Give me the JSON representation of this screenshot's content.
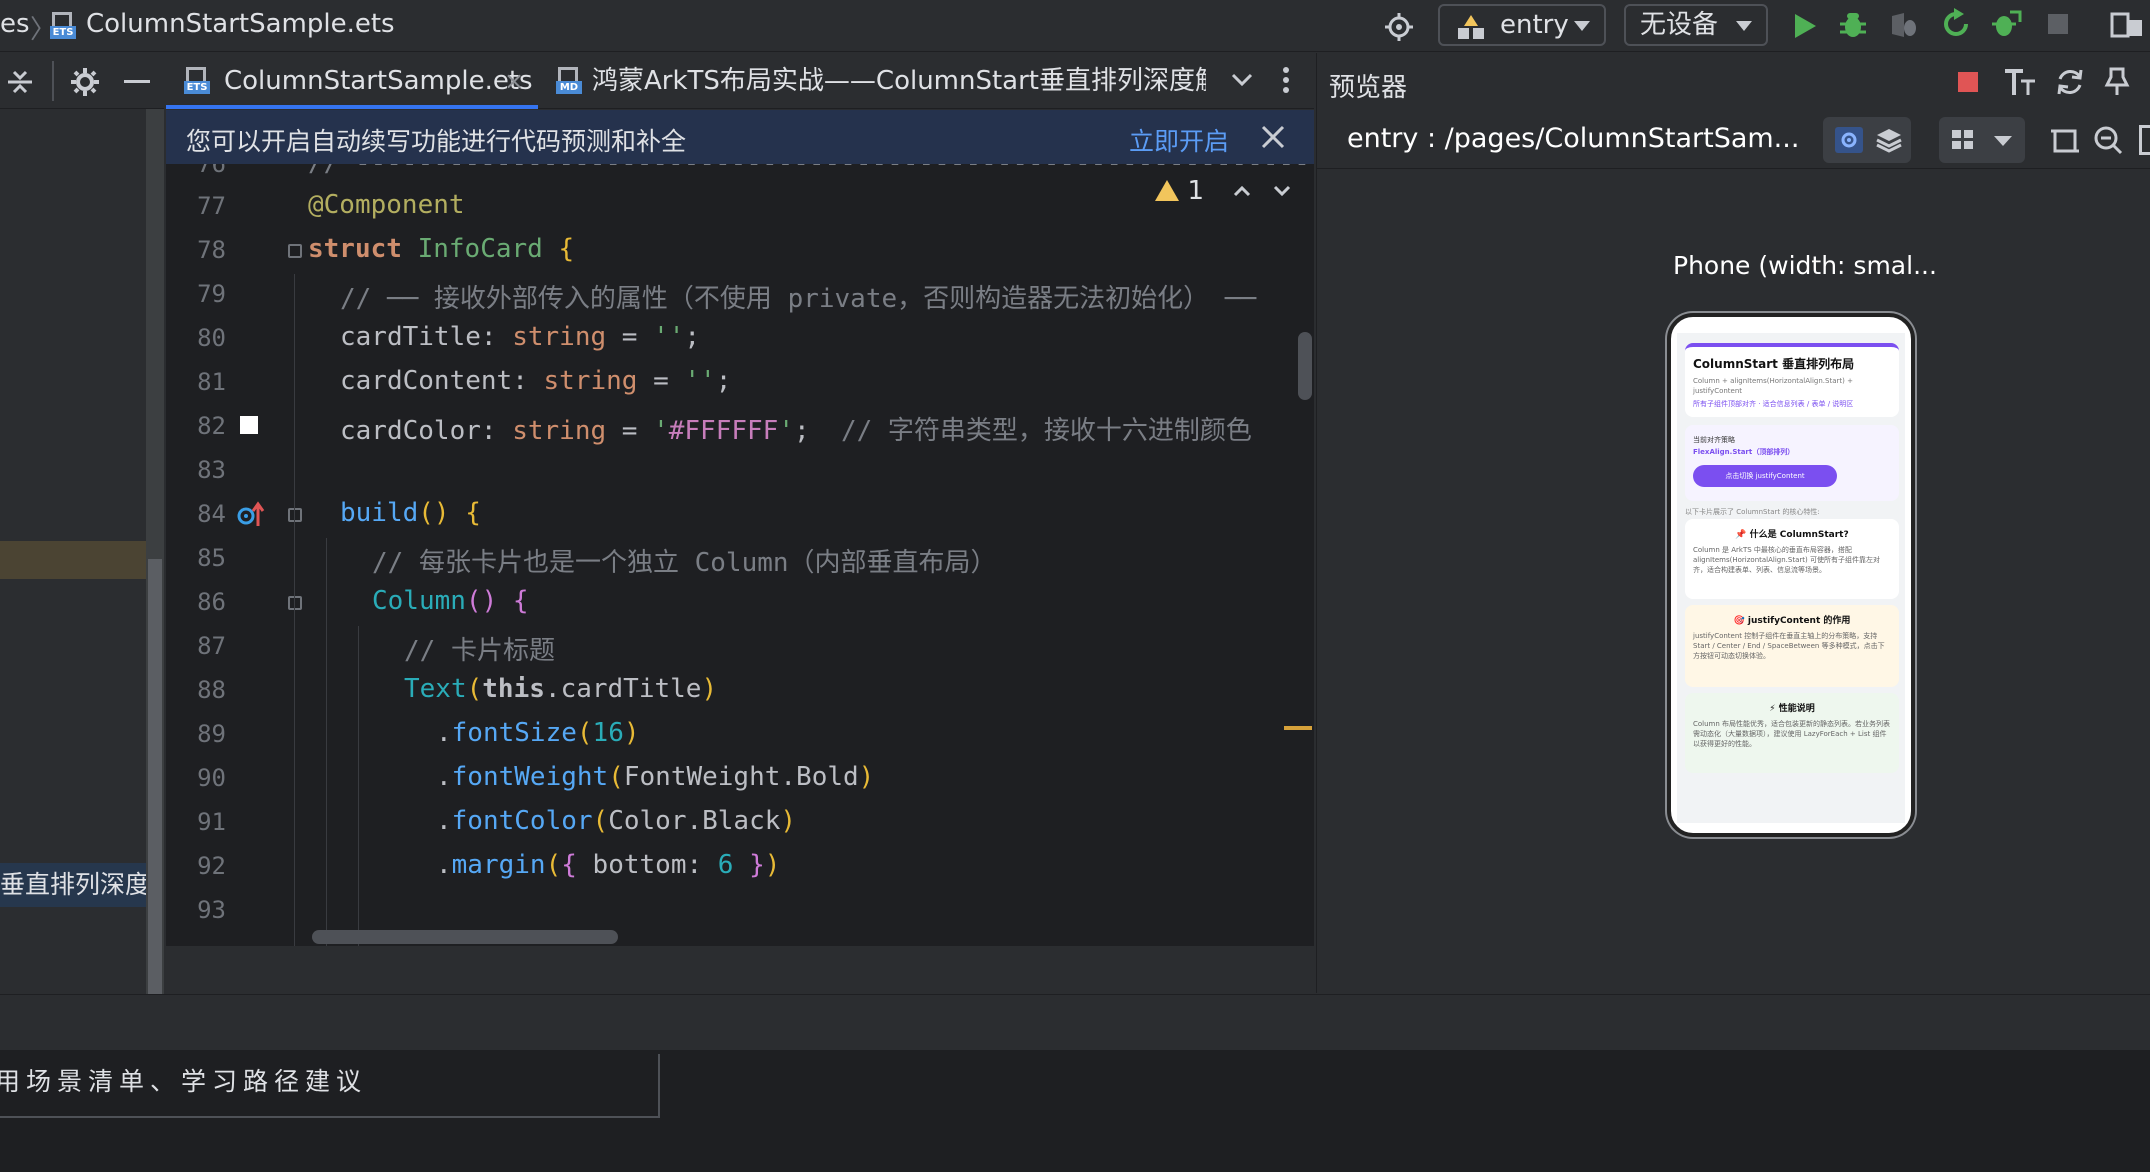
{
  "topbar": {
    "breadcrumb_prefix": "es",
    "file_name": "ColumnStartSample.ets",
    "ets_tag": "ETS",
    "run_config": "entry",
    "device": "无设备"
  },
  "editor_tabs": [
    {
      "label": "ColumnStartSample.ets",
      "icon": "ets-file-icon",
      "tag": "ETS",
      "active": true,
      "close": "×"
    },
    {
      "label": "鸿蒙ArkTS布局实战——ColumnStart垂直排列深度解析.",
      "icon": "markdown-file-icon",
      "tag": "MD",
      "active": false
    }
  ],
  "left_panel": {
    "selected_item": "垂直排列深度解"
  },
  "notification": {
    "message": "您可以开启自动续写功能进行代码预测和补全",
    "action": "立即开启"
  },
  "inspection": {
    "warnings": "1"
  },
  "code": {
    "line_numbers": [
      "76",
      "77",
      "78",
      "79",
      "80",
      "81",
      "82",
      "83",
      "84",
      "85",
      "86",
      "87",
      "88",
      "89",
      "90",
      "91",
      "92",
      "93"
    ],
    "l76": "// ---------------------------------------------------------------------",
    "l77": "@Component",
    "l78_kw": "struct",
    "l78_name": "InfoCard",
    "l78_brace": "{",
    "l79": "// ── 接收外部传入的属性（不使用 private，否则构造器无法初始化） ──",
    "l80_prop": "cardTitle",
    "l80_type": "string",
    "l80_val": "''",
    "l81_prop": "cardContent",
    "l81_type": "string",
    "l81_val": "''",
    "l82_prop": "cardColor",
    "l82_type": "string",
    "l82_val": "'#FFFFFF'",
    "l82_cmt": "// 字符串类型，接收十六进制颜色",
    "l84_fn": "build",
    "l85": "// 每张卡片也是一个独立 Column（内部垂直布局）",
    "l86_fn": "Column",
    "l87": "// 卡片标题",
    "l88_fn": "Text",
    "l88_this": "this",
    "l88_prop": "cardTitle",
    "l89_fn": "fontSize",
    "l89_num": "16",
    "l90_fn": "fontWeight",
    "l90_arg": "FontWeight.Bold",
    "l91_fn": "fontColor",
    "l91_arg": "Color.Black",
    "l92_fn": "margin",
    "l92_key": "bottom",
    "l92_num": "6"
  },
  "previewer": {
    "title": "预览器",
    "route": "entry : /pages/ColumnStartSam...",
    "device_label": "Phone (width: smal...",
    "app": {
      "header_title": "ColumnStart 垂直排列布局",
      "header_sub1": "Column + alignItems(HorizontalAlign.Start) +",
      "header_sub2": "justifyContent",
      "header_sub3": "所有子组件顶部对齐 · 适合信息列表 / 表单 / 说明区",
      "current_label": "当前对齐策略",
      "current_value": "FlexAlign.Start（顶部排列）",
      "switch_button": "点击切换 justifyContent",
      "section_note": "以下卡片展示了 ColumnStart 的核心特性:",
      "cards": [
        {
          "title": "📌 什么是 ColumnStart?",
          "body": "Column 是 ArkTS 中最核心的垂直布局容器，搭配 alignItems(HorizontalAlign.Start) 可使所有子组件靠左对齐，适合构建表单、列表、信息流等场景。",
          "bg": "#ffffff"
        },
        {
          "title": "🎯 justifyContent 的作用",
          "body": "justifyContent 控制子组件在垂直主轴上的分布策略，支持 Start / Center / End / SpaceBetween 等多种模式，点击下方按钮可动态切换体验。",
          "bg": "#fff7e6"
        },
        {
          "title": "⚡ 性能说明",
          "body": "Column 布局性能优秀，适合包装更新的静态列表。若业务列表需动态化（大量数据项），建议使用 LazyForEach + List 组件以获得更好的性能。",
          "bg": "#eef7ee"
        }
      ]
    }
  },
  "bottom": {
    "input_text": "适用场景清单、学习路径建议"
  },
  "colors": {
    "accent": "#3574f0",
    "purple_button": "#7b4ff0",
    "warning": "#f2c55c",
    "run_green": "#4fb055"
  }
}
